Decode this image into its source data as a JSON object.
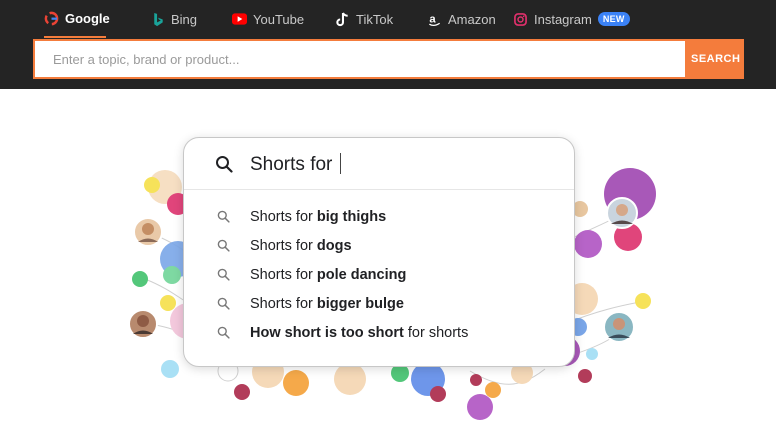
{
  "tabs": [
    {
      "label": "Google",
      "icon": "google-icon",
      "active": true
    },
    {
      "label": "Bing",
      "icon": "bing-icon"
    },
    {
      "label": "YouTube",
      "icon": "youtube-icon"
    },
    {
      "label": "TikTok",
      "icon": "tiktok-icon"
    },
    {
      "label": "Amazon",
      "icon": "amazon-icon"
    },
    {
      "label": "Instagram",
      "icon": "instagram-icon",
      "badge": "NEW"
    }
  ],
  "search": {
    "placeholder": "Enter a topic, brand or product...",
    "button_label": "SEARCH"
  },
  "panel": {
    "query": "Shorts for",
    "suggestions": [
      {
        "prefix": "Shorts for ",
        "bold": "big thighs",
        "suffix": ""
      },
      {
        "prefix": "Shorts for ",
        "bold": "dogs",
        "suffix": ""
      },
      {
        "prefix": "Shorts for ",
        "bold": "pole dancing",
        "suffix": ""
      },
      {
        "prefix": "Shorts for ",
        "bold": "bigger bulge",
        "suffix": ""
      },
      {
        "prefix": "",
        "bold": "How short is too short",
        "suffix": " for shorts"
      }
    ]
  },
  "colors": {
    "accent": "#f47c3c",
    "topbar": "#242424"
  }
}
